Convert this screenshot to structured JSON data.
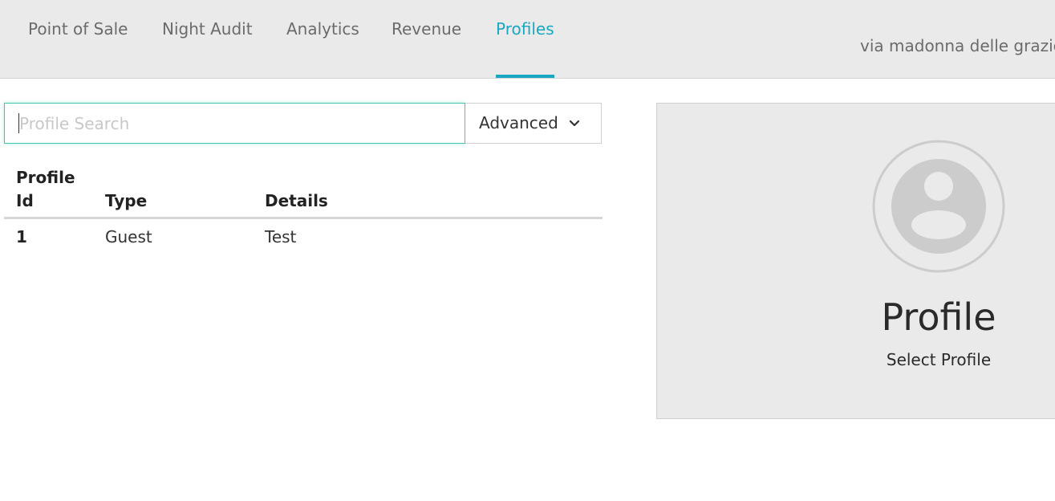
{
  "nav": {
    "tabs": [
      {
        "label": "Point of Sale",
        "active": false
      },
      {
        "label": "Night Audit",
        "active": false
      },
      {
        "label": "Analytics",
        "active": false
      },
      {
        "label": "Revenue",
        "active": false
      },
      {
        "label": "Profiles",
        "active": true
      }
    ],
    "property_name": "via madonna delle grazie"
  },
  "search": {
    "placeholder": "Profile Search",
    "value": "",
    "advanced_label": "Advanced",
    "advanced_icon": "chevron-down-icon"
  },
  "table": {
    "headers": {
      "id": "Profile Id",
      "type": "Type",
      "details": "Details"
    },
    "rows": [
      {
        "id": "1",
        "type": "Guest",
        "details": "Test"
      }
    ]
  },
  "profile_card": {
    "title": "Profile",
    "subtitle": "Select Profile",
    "avatar_icon": "user-avatar-icon"
  },
  "colors": {
    "accent": "#1aa7c4",
    "focus": "#3fc6b3",
    "panel": "#eaeaea"
  }
}
